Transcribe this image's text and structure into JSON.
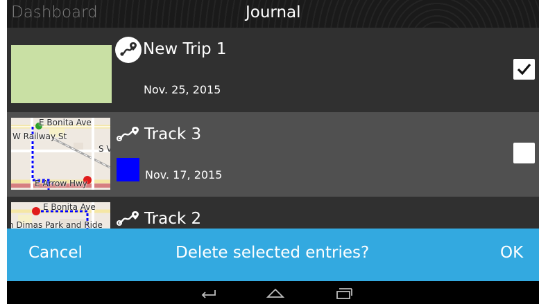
{
  "header": {
    "left_label": "Dashboard",
    "title": "Journal"
  },
  "entries": [
    {
      "name": "New Trip 1",
      "date": "Nov. 25, 2015",
      "icon": "trip-route-icon",
      "checked": true,
      "thumbnail": "plain-green"
    },
    {
      "name": "Track 3",
      "date": "Nov. 17, 2015",
      "icon": "track-route-icon",
      "color": "#0000ff",
      "checked": false,
      "thumbnail": "map",
      "map_labels": [
        "E Bonita Ave",
        "W Railway St",
        "S V",
        "E Arrow Hwy"
      ]
    },
    {
      "name": "Track 2",
      "icon": "track-route-icon",
      "checked": false,
      "thumbnail": "map",
      "map_labels": [
        "E Bonita Ave",
        "n Dimas Park and Ride"
      ]
    }
  ],
  "dialog": {
    "cancel_label": "Cancel",
    "prompt": "Delete selected entries?",
    "ok_label": "OK"
  },
  "navbar": {
    "buttons": [
      "back-icon",
      "home-icon",
      "recents-icon"
    ]
  },
  "colors": {
    "accent": "#33a9e0",
    "selected_row": "#505050",
    "row": "#303030",
    "track3_color": "#0000ff"
  }
}
